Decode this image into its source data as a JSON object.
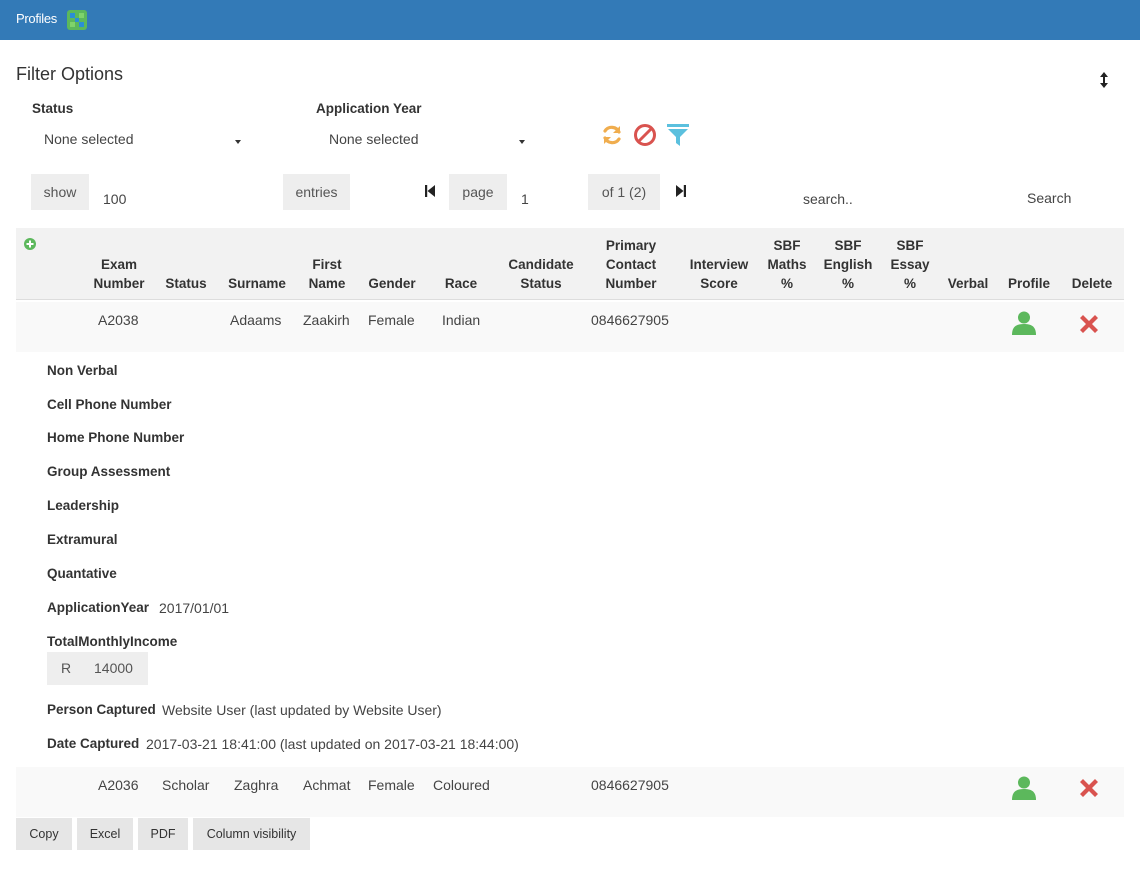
{
  "header": {
    "title": "Profiles",
    "logo_icon": "grid-logo-icon"
  },
  "filter": {
    "title": "Filter Options",
    "status_label": "Status",
    "status_value": "None selected",
    "year_label": "Application Year",
    "year_value": "None selected"
  },
  "paging": {
    "show_label": "show",
    "show_value": "100",
    "entries_label": "entries",
    "page_label": "page",
    "page_value": "1",
    "of_label": "of 1 (2)",
    "search_placeholder": "search..",
    "search_button": "Search"
  },
  "table": {
    "headers": {
      "exam": [
        "Exam",
        "Number"
      ],
      "status": "Status",
      "surname": "Surname",
      "first": [
        "First",
        "Name"
      ],
      "gender": "Gender",
      "race": "Race",
      "candidate": [
        "Candidate",
        "Status"
      ],
      "contact": [
        "Primary",
        "Contact",
        "Number"
      ],
      "interview": [
        "Interview",
        "Score"
      ],
      "sbf_maths": [
        "SBF",
        "Maths",
        "%"
      ],
      "sbf_english": [
        "SBF",
        "English",
        "%"
      ],
      "sbf_essay": [
        "SBF",
        "Essay",
        "%"
      ],
      "verbal": "Verbal",
      "profile": "Profile",
      "delete": "Delete"
    },
    "rows": [
      {
        "exam": "A2038",
        "status": "",
        "surname": "Adaams",
        "first": "Zaakirh",
        "gender": "Female",
        "race": "Indian",
        "contact": "0846627905"
      },
      {
        "exam": "A2036",
        "status": "Scholar",
        "surname": "Zaghra",
        "first": "Achmat",
        "gender": "Female",
        "race": "Coloured",
        "contact": "0846627905"
      }
    ]
  },
  "details": {
    "non_verbal": "Non Verbal",
    "cell_phone": "Cell Phone Number",
    "home_phone": "Home Phone Number",
    "group_assessment": "Group Assessment",
    "leadership": "Leadership",
    "extramural": "Extramural",
    "quantative": "Quantative",
    "application_year_label": "ApplicationYear",
    "application_year_value": "2017/01/01",
    "income_label": "TotalMonthlyIncome",
    "income_currency": "R",
    "income_value": "14000",
    "person_captured_label": "Person Captured",
    "person_captured_value": "Website User (last updated by Website User)",
    "date_captured_label": "Date Captured",
    "date_captured_value": "2017-03-21 18:41:00 (last updated on 2017-03-21 18:44:00)"
  },
  "buttons": {
    "copy": "Copy",
    "excel": "Excel",
    "pdf": "PDF",
    "colvis": "Column visibility"
  },
  "colors": {
    "header_bg": "#337ab7",
    "refresh": "#f0ad4e",
    "ban": "#d9534f",
    "filter": "#5bc0de",
    "profile": "#5cb85c",
    "delete": "#d9534f"
  }
}
